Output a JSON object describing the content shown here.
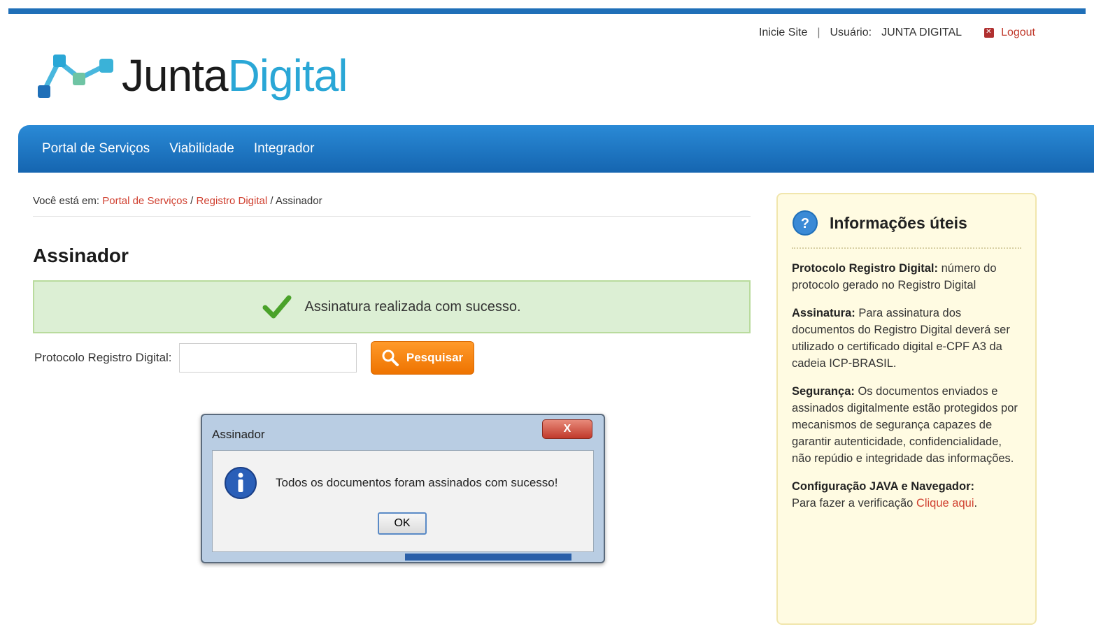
{
  "header": {
    "utility": {
      "home_link": "Inicie Site",
      "separator": "|",
      "user_label": "Usuário:",
      "user_name": "JUNTA DIGITAL",
      "logout": "Logout"
    },
    "logo": {
      "part1": "Junta",
      "part2": "Digital"
    }
  },
  "nav": {
    "items": [
      {
        "label": "Portal de Serviços"
      },
      {
        "label": "Viabilidade"
      },
      {
        "label": "Integrador"
      }
    ]
  },
  "breadcrumb": {
    "prefix": "Você está em:",
    "item1": "Portal de Serviços",
    "sep1": "/",
    "item2": "Registro Digital",
    "current": "/ Assinador"
  },
  "page": {
    "title": "Assinador",
    "success_message": "Assinatura realizada com sucesso.",
    "search": {
      "label": "Protocolo Registro Digital:",
      "value": "",
      "button": "Pesquisar"
    }
  },
  "dialog": {
    "title": "Assinador",
    "close": "X",
    "message": "Todos os documentos foram assinados com sucesso!",
    "ok": "OK"
  },
  "sidebar": {
    "title": "Informações úteis",
    "items": [
      {
        "label": "Protocolo Registro Digital:",
        "text": "número do protocolo gerado no Registro Digital"
      },
      {
        "label": "Assinatura:",
        "text": "Para assinatura dos documentos do Registro Digital deverá ser utilizado o certificado digital e-CPF A3 da cadeia ICP-BRASIL."
      },
      {
        "label": "Segurança:",
        "text": "Os documentos enviados e assinados digitalmente estão protegidos por mecanismos de segurança capazes de garantir autenticidade, confidencialidade, não repúdio e integridade das informações."
      },
      {
        "label": "Configuração JAVA e Navegador:",
        "text": "Para fazer a verificação",
        "link": "Clique aqui",
        "end": "."
      }
    ]
  },
  "colors": {
    "brand_blue": "#1f6fb8",
    "logo_cyan": "#2aa7d6",
    "accent_orange": "#f28a12",
    "success_green": "#dcefd4",
    "link_red": "#d04030"
  },
  "icons": [
    "logo-mark-icon",
    "logout-icon",
    "check-icon",
    "search-icon",
    "info-icon",
    "help-icon",
    "close-icon"
  ]
}
